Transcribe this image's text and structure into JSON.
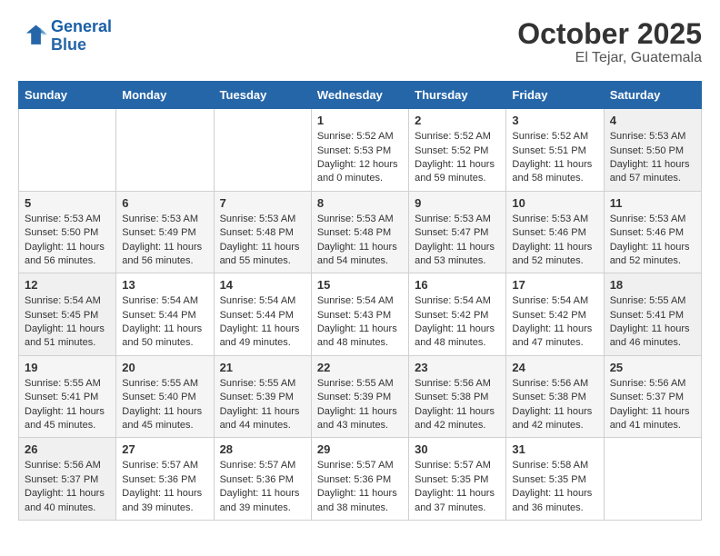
{
  "header": {
    "logo_line1": "General",
    "logo_line2": "Blue",
    "month_year": "October 2025",
    "location": "El Tejar, Guatemala"
  },
  "weekdays": [
    "Sunday",
    "Monday",
    "Tuesday",
    "Wednesday",
    "Thursday",
    "Friday",
    "Saturday"
  ],
  "weeks": [
    [
      {
        "day": "",
        "info": ""
      },
      {
        "day": "",
        "info": ""
      },
      {
        "day": "",
        "info": ""
      },
      {
        "day": "1",
        "info": "Sunrise: 5:52 AM\nSunset: 5:53 PM\nDaylight: 12 hours\nand 0 minutes."
      },
      {
        "day": "2",
        "info": "Sunrise: 5:52 AM\nSunset: 5:52 PM\nDaylight: 11 hours\nand 59 minutes."
      },
      {
        "day": "3",
        "info": "Sunrise: 5:52 AM\nSunset: 5:51 PM\nDaylight: 11 hours\nand 58 minutes."
      },
      {
        "day": "4",
        "info": "Sunrise: 5:53 AM\nSunset: 5:50 PM\nDaylight: 11 hours\nand 57 minutes."
      }
    ],
    [
      {
        "day": "5",
        "info": "Sunrise: 5:53 AM\nSunset: 5:50 PM\nDaylight: 11 hours\nand 56 minutes."
      },
      {
        "day": "6",
        "info": "Sunrise: 5:53 AM\nSunset: 5:49 PM\nDaylight: 11 hours\nand 56 minutes."
      },
      {
        "day": "7",
        "info": "Sunrise: 5:53 AM\nSunset: 5:48 PM\nDaylight: 11 hours\nand 55 minutes."
      },
      {
        "day": "8",
        "info": "Sunrise: 5:53 AM\nSunset: 5:48 PM\nDaylight: 11 hours\nand 54 minutes."
      },
      {
        "day": "9",
        "info": "Sunrise: 5:53 AM\nSunset: 5:47 PM\nDaylight: 11 hours\nand 53 minutes."
      },
      {
        "day": "10",
        "info": "Sunrise: 5:53 AM\nSunset: 5:46 PM\nDaylight: 11 hours\nand 52 minutes."
      },
      {
        "day": "11",
        "info": "Sunrise: 5:53 AM\nSunset: 5:46 PM\nDaylight: 11 hours\nand 52 minutes."
      }
    ],
    [
      {
        "day": "12",
        "info": "Sunrise: 5:54 AM\nSunset: 5:45 PM\nDaylight: 11 hours\nand 51 minutes."
      },
      {
        "day": "13",
        "info": "Sunrise: 5:54 AM\nSunset: 5:44 PM\nDaylight: 11 hours\nand 50 minutes."
      },
      {
        "day": "14",
        "info": "Sunrise: 5:54 AM\nSunset: 5:44 PM\nDaylight: 11 hours\nand 49 minutes."
      },
      {
        "day": "15",
        "info": "Sunrise: 5:54 AM\nSunset: 5:43 PM\nDaylight: 11 hours\nand 48 minutes."
      },
      {
        "day": "16",
        "info": "Sunrise: 5:54 AM\nSunset: 5:42 PM\nDaylight: 11 hours\nand 48 minutes."
      },
      {
        "day": "17",
        "info": "Sunrise: 5:54 AM\nSunset: 5:42 PM\nDaylight: 11 hours\nand 47 minutes."
      },
      {
        "day": "18",
        "info": "Sunrise: 5:55 AM\nSunset: 5:41 PM\nDaylight: 11 hours\nand 46 minutes."
      }
    ],
    [
      {
        "day": "19",
        "info": "Sunrise: 5:55 AM\nSunset: 5:41 PM\nDaylight: 11 hours\nand 45 minutes."
      },
      {
        "day": "20",
        "info": "Sunrise: 5:55 AM\nSunset: 5:40 PM\nDaylight: 11 hours\nand 45 minutes."
      },
      {
        "day": "21",
        "info": "Sunrise: 5:55 AM\nSunset: 5:39 PM\nDaylight: 11 hours\nand 44 minutes."
      },
      {
        "day": "22",
        "info": "Sunrise: 5:55 AM\nSunset: 5:39 PM\nDaylight: 11 hours\nand 43 minutes."
      },
      {
        "day": "23",
        "info": "Sunrise: 5:56 AM\nSunset: 5:38 PM\nDaylight: 11 hours\nand 42 minutes."
      },
      {
        "day": "24",
        "info": "Sunrise: 5:56 AM\nSunset: 5:38 PM\nDaylight: 11 hours\nand 42 minutes."
      },
      {
        "day": "25",
        "info": "Sunrise: 5:56 AM\nSunset: 5:37 PM\nDaylight: 11 hours\nand 41 minutes."
      }
    ],
    [
      {
        "day": "26",
        "info": "Sunrise: 5:56 AM\nSunset: 5:37 PM\nDaylight: 11 hours\nand 40 minutes."
      },
      {
        "day": "27",
        "info": "Sunrise: 5:57 AM\nSunset: 5:36 PM\nDaylight: 11 hours\nand 39 minutes."
      },
      {
        "day": "28",
        "info": "Sunrise: 5:57 AM\nSunset: 5:36 PM\nDaylight: 11 hours\nand 39 minutes."
      },
      {
        "day": "29",
        "info": "Sunrise: 5:57 AM\nSunset: 5:36 PM\nDaylight: 11 hours\nand 38 minutes."
      },
      {
        "day": "30",
        "info": "Sunrise: 5:57 AM\nSunset: 5:35 PM\nDaylight: 11 hours\nand 37 minutes."
      },
      {
        "day": "31",
        "info": "Sunrise: 5:58 AM\nSunset: 5:35 PM\nDaylight: 11 hours\nand 36 minutes."
      },
      {
        "day": "",
        "info": ""
      }
    ]
  ]
}
